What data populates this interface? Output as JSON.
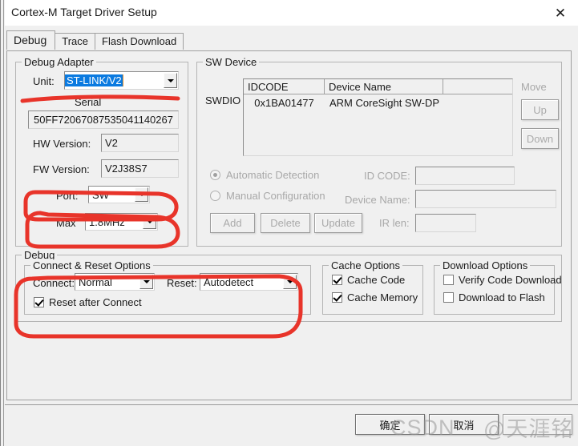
{
  "window": {
    "title": "Cortex-M Target Driver Setup",
    "close_icon": "close-icon"
  },
  "tabs": [
    {
      "label": "Debug",
      "active": true
    },
    {
      "label": "Trace",
      "active": false
    },
    {
      "label": "Flash Download",
      "active": false
    }
  ],
  "debug_adapter": {
    "legend": "Debug Adapter",
    "unit_label": "Unit:",
    "unit_value": "ST-LINK/V2",
    "serial_label": "Serial",
    "serial_value": "50FF72067087535041140267",
    "hw_version_label": "HW Version:",
    "hw_version_value": "V2",
    "fw_version_label": "FW Version:",
    "fw_version_value": "V2J38S7",
    "port_label": "Port:",
    "port_value": "SW",
    "max_label": "Max",
    "max_value": "1.8MHz"
  },
  "sw_device": {
    "legend": "SW Device",
    "swdio_label": "SWDIO",
    "columns": [
      "IDCODE",
      "Device Name",
      ""
    ],
    "rows": [
      {
        "idcode": "0x1BA01477",
        "device_name": "ARM CoreSight SW-DP",
        "extra": ""
      }
    ],
    "move_label": "Move",
    "up_label": "Up",
    "down_label": "Down",
    "automatic_detection_label": "Automatic Detection",
    "manual_configuration_label": "Manual Configuration",
    "id_code_label": "ID CODE:",
    "id_code_value": "",
    "device_name_label": "Device Name:",
    "device_name_value": "",
    "ir_len_label": "IR len:",
    "ir_len_value": "",
    "add_label": "Add",
    "delete_label": "Delete",
    "update_label": "Update"
  },
  "debug_section": {
    "legend": "Debug",
    "connect_reset": {
      "legend": "Connect & Reset Options",
      "connect_label": "Connect:",
      "connect_value": "Normal",
      "reset_label": "Reset:",
      "reset_value": "Autodetect",
      "reset_after_connect_label": "Reset after Connect",
      "reset_after_connect_checked": true
    },
    "cache_options": {
      "legend": "Cache Options",
      "cache_code_label": "Cache Code",
      "cache_code_checked": true,
      "cache_memory_label": "Cache Memory",
      "cache_memory_checked": true
    },
    "download_options": {
      "legend": "Download Options",
      "verify_code_download_label": "Verify Code Download",
      "verify_code_download_checked": false,
      "download_to_flash_label": "Download to Flash",
      "download_to_flash_checked": false
    }
  },
  "footer": {
    "ok_label": "确定",
    "cancel_label": "取消",
    "help_label": ""
  },
  "watermark": {
    "text_left": "CSDN",
    "text_right": "@天涯铭"
  },
  "colors": {
    "annotation_red": "#e8342a",
    "selection_blue": "#0a7ae0",
    "focus_orange": "#e8912a",
    "window_bg": "#f0f0f0",
    "disabled_text": "#a8a8a8"
  }
}
